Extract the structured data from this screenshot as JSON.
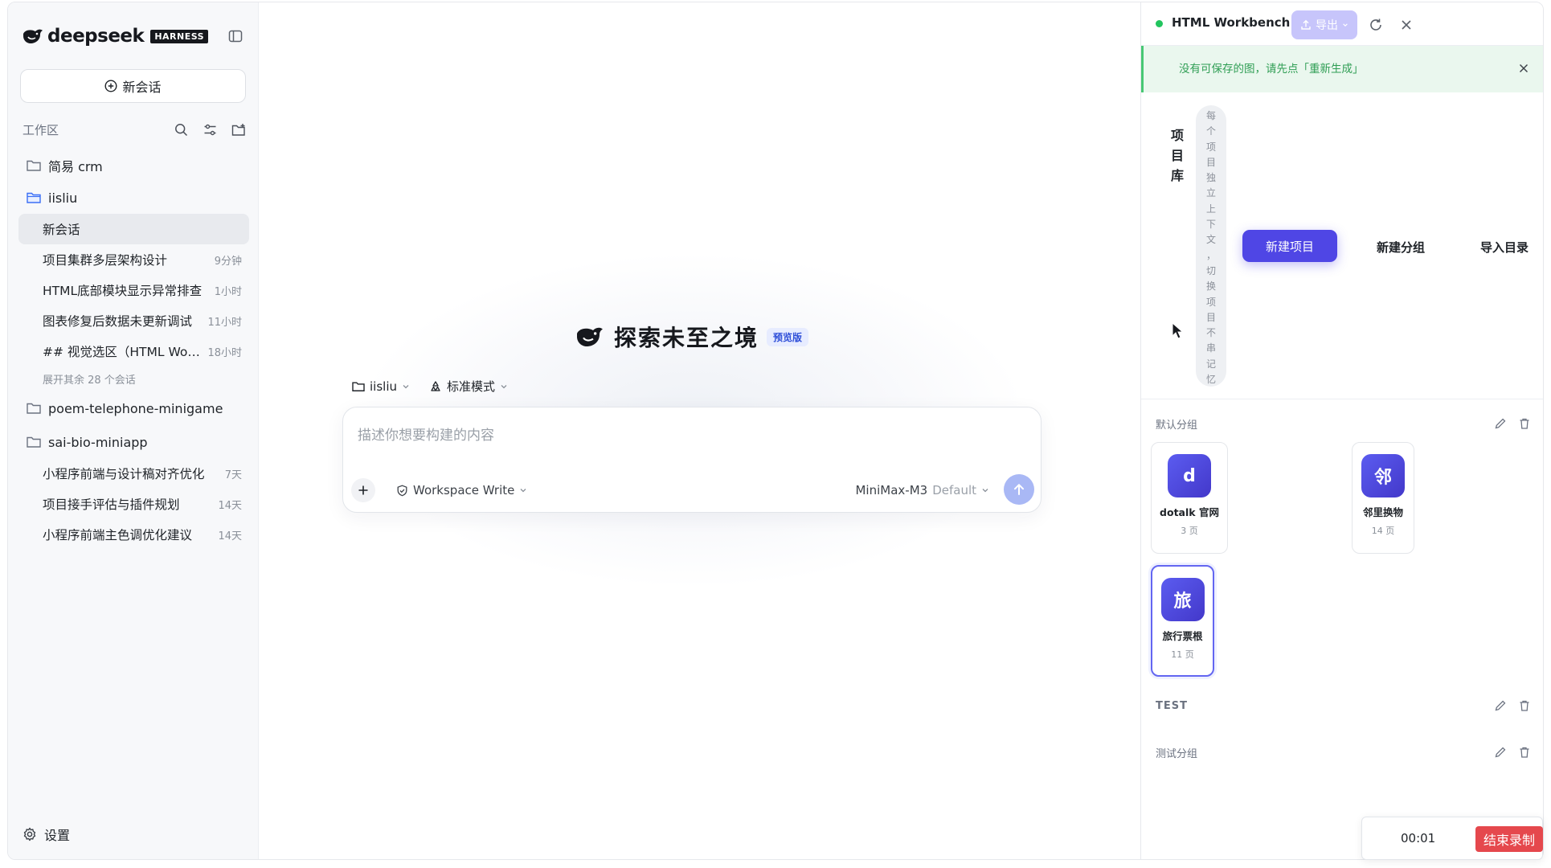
{
  "sidebar": {
    "logo_text": "deepseek",
    "logo_badge": "HARNESS",
    "new_chat_label": "新会话",
    "workspace_label": "工作区",
    "folders": [
      {
        "name": "简易 crm"
      },
      {
        "name": "iisliu"
      },
      {
        "name": "poem-telephone-minigame"
      },
      {
        "name": "sai-bio-miniapp"
      }
    ],
    "iisliu_convs": [
      {
        "title": "新会话",
        "time": ""
      },
      {
        "title": "项目集群多层架构设计",
        "time": "9分钟"
      },
      {
        "title": "HTML底部模块显示异常排查",
        "time": "1小时"
      },
      {
        "title": "图表修复后数据未更新调试",
        "time": "11小时"
      },
      {
        "title": "## 视觉选区（HTML Wor...",
        "time": "18小时"
      }
    ],
    "expand_more": "展开其余 28 个会话",
    "sai_convs": [
      {
        "title": "小程序前端与设计稿对齐优化",
        "time": "7天"
      },
      {
        "title": "项目接手评估与插件规划",
        "time": "14天"
      },
      {
        "title": "小程序前端主色调优化建议",
        "time": "14天"
      }
    ],
    "settings_label": "设置"
  },
  "main": {
    "hero_title": "探索未至之境",
    "hero_badge": "预览版",
    "ctx_folder": "iisliu",
    "ctx_mode": "标准模式",
    "composer_placeholder": "描述你想要构建的内容",
    "permission": "Workspace Write",
    "model_name": "MiniMax-M3",
    "model_default": "Default"
  },
  "rpanel": {
    "title": "HTML Workbench",
    "export_label": "导出",
    "notice": "没有可保存的图，请先点「重新生成」",
    "library_title": "项目库",
    "library_hint": "每个项目独立上下文，切换项目不串记忆",
    "new_project": "新建项目",
    "new_group": "新建分组",
    "import_dir": "导入目录",
    "groups": [
      {
        "name": "默认分组"
      },
      {
        "name": "TEST"
      },
      {
        "name": "测试分组"
      }
    ],
    "projects": [
      {
        "avatar": "d",
        "name": "dotalk 官网",
        "pages": "3 页"
      },
      {
        "avatar": "邻",
        "name": "邻里换物",
        "pages": "14 页"
      },
      {
        "avatar": "旅",
        "name": "旅行票根",
        "pages": "11 页"
      }
    ]
  },
  "recorder": {
    "time": "00:01",
    "stop_label": "结束录制"
  },
  "colors": {
    "accent": "#4f46e5",
    "success": "#22c55e",
    "notice_bg": "#eaf7ee",
    "record_red": "#e5484d"
  }
}
